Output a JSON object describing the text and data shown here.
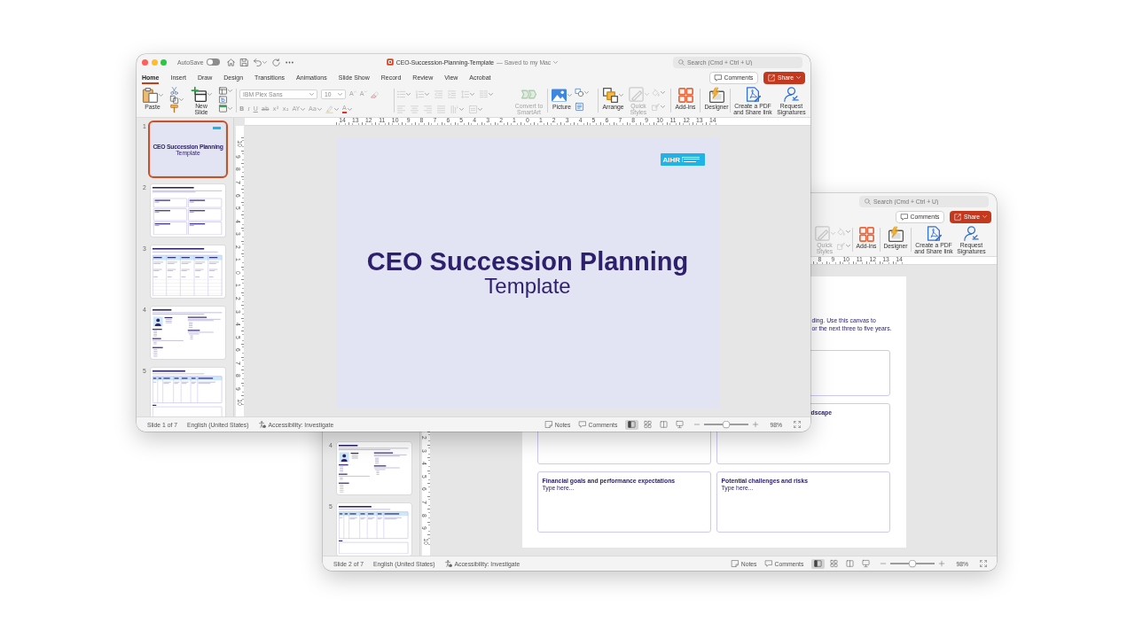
{
  "windows": [
    {
      "window_buttons": [
        {
          "kind": "close"
        },
        {
          "kind": "minimize"
        },
        {
          "kind": "fullscreen"
        }
      ],
      "autosave": {
        "label": "AutoSave",
        "on": false
      },
      "quick_access": [
        {
          "kind": "home",
          "menu": false
        },
        {
          "kind": "save",
          "menu": false
        },
        {
          "kind": "undo",
          "menu": true
        },
        {
          "kind": "redo",
          "menu": false
        },
        {
          "kind": "more",
          "menu": false
        }
      ],
      "document_title": "CEO-Succession-Planning-Template",
      "save_status": "— Saved to my Mac",
      "search": {
        "placeholder": "Search (Cmd + Ctrl + U)"
      },
      "tabs": [
        {
          "label": "Home",
          "selected": true
        },
        {
          "label": "Insert",
          "selected": false
        },
        {
          "label": "Draw",
          "selected": false
        },
        {
          "label": "Design",
          "selected": false
        },
        {
          "label": "Transitions",
          "selected": false
        },
        {
          "label": "Animations",
          "selected": false
        },
        {
          "label": "Slide Show",
          "selected": false
        },
        {
          "label": "Record",
          "selected": false
        },
        {
          "label": "Review",
          "selected": false
        },
        {
          "label": "View",
          "selected": false
        },
        {
          "label": "Acrobat",
          "selected": false
        }
      ],
      "comments_button": "Comments",
      "share_button": "Share",
      "ribbon": [
        {
          "items": [
            {
              "kind": "paste",
              "label": "Paste",
              "menu": true,
              "disabled": false
            },
            {
              "kind": "stack",
              "items": [
                {
                  "kind": "cut",
                  "menu": false,
                  "disabled": false
                },
                {
                  "kind": "copy",
                  "menu": true,
                  "disabled": false
                },
                {
                  "kind": "painter",
                  "menu": false,
                  "disabled": false
                }
              ]
            },
            {
              "kind": "newslide",
              "label": "New Slide",
              "menu": true,
              "disabled": false
            },
            {
              "kind": "stack",
              "items": [
                {
                  "kind": "layout",
                  "menu": true,
                  "disabled": false
                },
                {
                  "kind": "reset",
                  "menu": false,
                  "disabled": false
                },
                {
                  "kind": "section",
                  "menu": true,
                  "disabled": false
                }
              ]
            }
          ]
        },
        {
          "items": [
            {
              "kind": "rows",
              "top_row": [
                {
                  "kind": "fontname",
                  "value": "IBM Plex Sans",
                  "menu": true,
                  "disabled": true
                },
                {
                  "kind": "fontsize",
                  "value": "10",
                  "menu": true,
                  "disabled": true
                },
                {
                  "kind": "grow",
                  "glyph": "A",
                  "menu": false,
                  "disabled": true
                },
                {
                  "kind": "shrink",
                  "glyph": "A",
                  "menu": false,
                  "disabled": true
                },
                {
                  "kind": "clear",
                  "menu": false,
                  "disabled": true
                }
              ],
              "bottom_row": [
                {
                  "kind": "bold",
                  "glyph": "B",
                  "menu": false,
                  "disabled": true
                },
                {
                  "kind": "italic",
                  "glyph": "I",
                  "menu": false,
                  "disabled": true
                },
                {
                  "kind": "underline",
                  "glyph": "U",
                  "menu": false,
                  "disabled": true
                },
                {
                  "kind": "strike",
                  "glyph": "ab",
                  "menu": false,
                  "disabled": true
                },
                {
                  "kind": "superscript",
                  "glyph": "x²",
                  "menu": false,
                  "disabled": true
                },
                {
                  "kind": "subscript",
                  "glyph": "x₂",
                  "menu": false,
                  "disabled": true
                },
                {
                  "kind": "spacing",
                  "glyph": "AY",
                  "menu": true,
                  "disabled": true
                },
                {
                  "kind": "case",
                  "glyph": "Aa",
                  "menu": true,
                  "disabled": true
                },
                {
                  "kind": "highlight",
                  "menu": true,
                  "disabled": true
                },
                {
                  "kind": "fontcolor",
                  "glyph": "A",
                  "menu": true,
                  "disabled": true
                }
              ]
            }
          ]
        },
        {
          "items": [
            {
              "kind": "rows",
              "top_row": [
                {
                  "kind": "bullets",
                  "menu": true,
                  "disabled": true
                },
                {
                  "kind": "numbering",
                  "menu": true,
                  "disabled": true
                },
                {
                  "kind": "outdent",
                  "menu": false,
                  "disabled": true
                },
                {
                  "kind": "indent",
                  "menu": false,
                  "disabled": true
                },
                {
                  "kind": "linespacing",
                  "menu": true,
                  "disabled": true
                },
                {
                  "kind": "columns",
                  "menu": true,
                  "disabled": true
                }
              ],
              "bottom_row": [
                {
                  "kind": "alignleft",
                  "menu": false,
                  "disabled": true
                },
                {
                  "kind": "aligncenter",
                  "menu": false,
                  "disabled": true
                },
                {
                  "kind": "alignright",
                  "menu": false,
                  "disabled": true
                },
                {
                  "kind": "justify",
                  "menu": false,
                  "disabled": true
                },
                {
                  "kind": "textdirection",
                  "menu": true,
                  "disabled": true
                },
                {
                  "kind": "aligntext",
                  "menu": true,
                  "disabled": true
                }
              ]
            },
            {
              "kind": "smartart",
              "label": "Convert to SmartArt",
              "menu": false,
              "disabled": true
            }
          ]
        },
        {
          "items": [
            {
              "kind": "picture",
              "label": "Picture",
              "menu": true,
              "disabled": false
            },
            {
              "kind": "stack",
              "items": [
                {
                  "kind": "shapes",
                  "menu": true,
                  "disabled": false
                },
                {
                  "kind": "textbox",
                  "menu": false,
                  "disabled": false
                }
              ]
            }
          ]
        },
        {
          "items": [
            {
              "kind": "arrange",
              "label": "Arrange",
              "menu": true,
              "disabled": false
            },
            {
              "kind": "quickstyles",
              "label": "Quick Styles",
              "menu": true,
              "disabled": true
            },
            {
              "kind": "stack",
              "items": [
                {
                  "kind": "fill",
                  "menu": true,
                  "disabled": true
                },
                {
                  "kind": "outline",
                  "menu": true,
                  "disabled": true
                }
              ]
            }
          ]
        },
        {
          "items": [
            {
              "kind": "addins",
              "label": "Add-ins",
              "menu": false,
              "disabled": false
            }
          ]
        },
        {
          "items": [
            {
              "kind": "designer",
              "label": "Designer",
              "menu": false,
              "disabled": false
            }
          ]
        },
        {
          "items": [
            {
              "kind": "pdf",
              "label": "Create a PDF and Share link",
              "menu": false,
              "disabled": false
            },
            {
              "kind": "signature",
              "label": "Request Signatures",
              "menu": false,
              "disabled": false
            }
          ]
        }
      ],
      "ruler": [
        "14",
        "13",
        "12",
        "11",
        "10",
        "9",
        "8",
        "7",
        "6",
        "5",
        "4",
        "3",
        "2",
        "1",
        "0",
        "1",
        "2",
        "3",
        "4",
        "5",
        "6",
        "7",
        "8",
        "9",
        "10",
        "11",
        "12",
        "13",
        "14"
      ],
      "vertical_ruler": [
        "10",
        "9",
        "8",
        "7",
        "6",
        "5",
        "4",
        "3",
        "2",
        "1",
        "0",
        "1",
        "2",
        "3",
        "4",
        "5",
        "6",
        "7",
        "8",
        "9",
        "10"
      ],
      "thumbnails": [
        {
          "number": "1",
          "selected": true,
          "slide": {
            "kind": "title",
            "logo": true,
            "title": "CEO Succession Planning",
            "subtitle": "Template"
          }
        },
        {
          "number": "2",
          "selected": false,
          "slide": {
            "kind": "boxes"
          }
        },
        {
          "number": "3",
          "selected": false,
          "slide": {
            "kind": "table"
          }
        },
        {
          "number": "4",
          "selected": false,
          "slide": {
            "kind": "profile"
          }
        },
        {
          "number": "5",
          "selected": false,
          "slide": {
            "kind": "candidates"
          }
        }
      ],
      "slide": {
        "kind": "title",
        "logo": {
          "name": "AIHR"
        },
        "title": "CEO Succession Planning",
        "subtitle": "Template"
      },
      "status_bar": {
        "slide_position": "Slide 1 of 7",
        "language": "English (United States)",
        "accessibility": "Accessibility: Investigate",
        "notes_button": "Notes",
        "comments_button": "Comments",
        "views": [
          {
            "kind": "normal",
            "selected": true
          },
          {
            "kind": "sorter",
            "selected": false
          },
          {
            "kind": "reading",
            "selected": false
          },
          {
            "kind": "slideshow",
            "selected": false
          }
        ],
        "zoom": {
          "level": 0.5,
          "reading": "98%"
        }
      }
    },
    {
      "search": {
        "placeholder": "Search (Cmd + Ctrl + U)"
      },
      "comments_button": "Comments",
      "share_button": "Share",
      "ribbon": [
        {
          "items": [
            {
              "kind": "quickstyles",
              "label": "Quick Styles",
              "menu": true,
              "disabled": true
            },
            {
              "kind": "stack",
              "items": [
                {
                  "kind": "fill",
                  "menu": true,
                  "disabled": true
                },
                {
                  "kind": "outline",
                  "menu": true,
                  "disabled": true
                }
              ]
            }
          ]
        },
        {
          "items": [
            {
              "kind": "addins",
              "label": "Add-ins",
              "menu": false,
              "disabled": false
            }
          ]
        },
        {
          "items": [
            {
              "kind": "designer",
              "label": "Designer",
              "menu": false,
              "disabled": false
            }
          ]
        },
        {
          "items": [
            {
              "kind": "pdf",
              "label": "Create a PDF and Share link",
              "menu": false,
              "disabled": false
            },
            {
              "kind": "signature",
              "label": "Request Signatures",
              "menu": false,
              "disabled": false
            }
          ]
        }
      ],
      "ruler": [
        "8",
        "9",
        "10",
        "11",
        "12",
        "13",
        "14"
      ],
      "vertical_ruler": [
        "2",
        "3",
        "4",
        "5",
        "6",
        "7",
        "8",
        "9",
        "10"
      ],
      "thumbnails": [
        {
          "number": "4",
          "selected": false,
          "slide": {
            "kind": "profile"
          }
        },
        {
          "number": "5",
          "selected": false,
          "slide": {
            "kind": "candidates"
          }
        }
      ],
      "slide": {
        "kind": "boxes",
        "description_lines": [
          "ding. Use this canvas to",
          "or the next three to five years."
        ],
        "boxes": [
          {
            "kind": "frame"
          },
          {
            "kind": "frame"
          },
          {
            "kind": "cut",
            "title": "dscape"
          },
          {
            "kind": "field",
            "title": "Financial goals and performance expectations",
            "body": "Type here..."
          },
          {
            "kind": "field",
            "title": "Potential challenges and risks",
            "body": "Type here..."
          }
        ]
      },
      "status_bar": {
        "slide_position": "Slide 2 of 7",
        "language": "English (United States)",
        "accessibility": "Accessibility: Investigate",
        "notes_button": "Notes",
        "comments_button": "Comments",
        "views": [
          {
            "kind": "normal",
            "selected": true
          },
          {
            "kind": "sorter",
            "selected": false
          },
          {
            "kind": "reading",
            "selected": false
          },
          {
            "kind": "slideshow",
            "selected": false
          }
        ],
        "zoom": {
          "level": 0.5,
          "reading": "98%"
        }
      }
    }
  ]
}
